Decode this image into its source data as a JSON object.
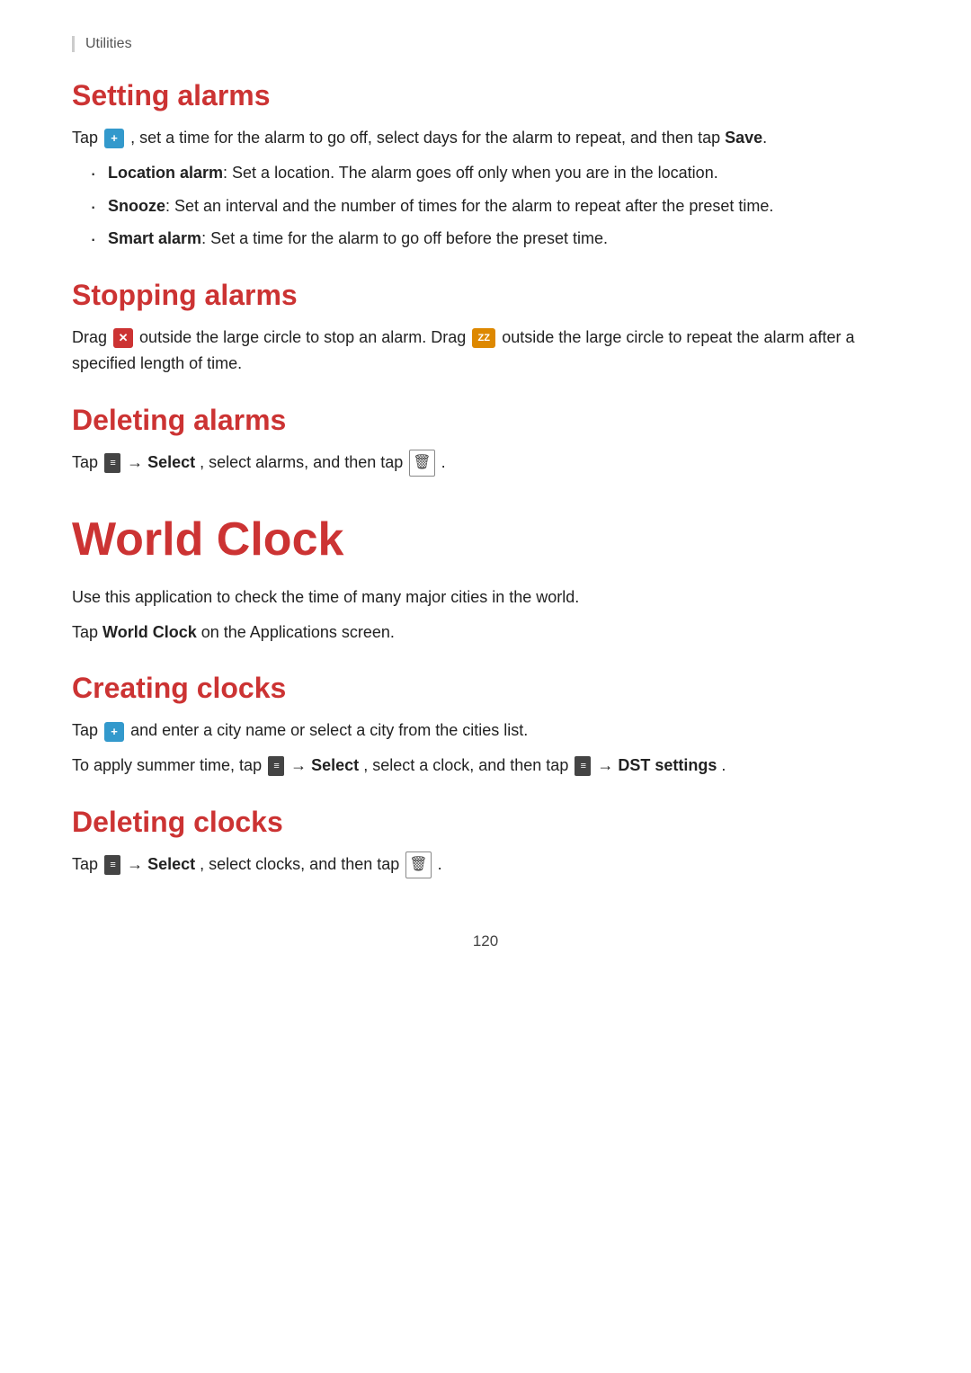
{
  "utilities_label": "Utilities",
  "setting_alarms": {
    "heading": "Setting alarms",
    "intro": "Tap",
    "intro_mid": ", set a time for the alarm to go off, select days for the alarm to repeat, and then tap",
    "save_bold": "Save",
    "intro_end": ".",
    "bullets": [
      {
        "term": "Location alarm",
        "description": ": Set a location. The alarm goes off only when you are in the location."
      },
      {
        "term": "Snooze",
        "description": ": Set an interval and the number of times for the alarm to repeat after the preset time."
      },
      {
        "term": "Smart alarm",
        "description": ": Set a time for the alarm to go off before the preset time."
      }
    ]
  },
  "stopping_alarms": {
    "heading": "Stopping alarms",
    "text1": "Drag",
    "text2": "outside the large circle to stop an alarm. Drag",
    "text3": "outside the large circle to repeat the alarm after a specified length of time."
  },
  "deleting_alarms": {
    "heading": "Deleting alarms",
    "text1": "Tap",
    "text2": "→",
    "select_bold": "Select",
    "text3": ", select alarms, and then tap",
    "text4": "."
  },
  "world_clock": {
    "heading": "World Clock",
    "desc1": "Use this application to check the time of many major cities in the world.",
    "desc2": "Tap",
    "desc2_bold": "World Clock",
    "desc2_end": "on the Applications screen."
  },
  "creating_clocks": {
    "heading": "Creating clocks",
    "text1": "Tap",
    "text1_end": "and enter a city name or select a city from the cities list.",
    "text2": "To apply summer time, tap",
    "text2_arrow": "→",
    "text2_select": "Select",
    "text2_mid": ", select a clock, and then tap",
    "text2_arrow2": "→",
    "text2_dst": "DST settings",
    "text2_end": "."
  },
  "deleting_clocks": {
    "heading": "Deleting clocks",
    "text1": "Tap",
    "text1_arrow": "→",
    "text1_select": "Select",
    "text1_mid": ", select clocks, and then tap",
    "text1_end": "."
  },
  "page_number": "120"
}
